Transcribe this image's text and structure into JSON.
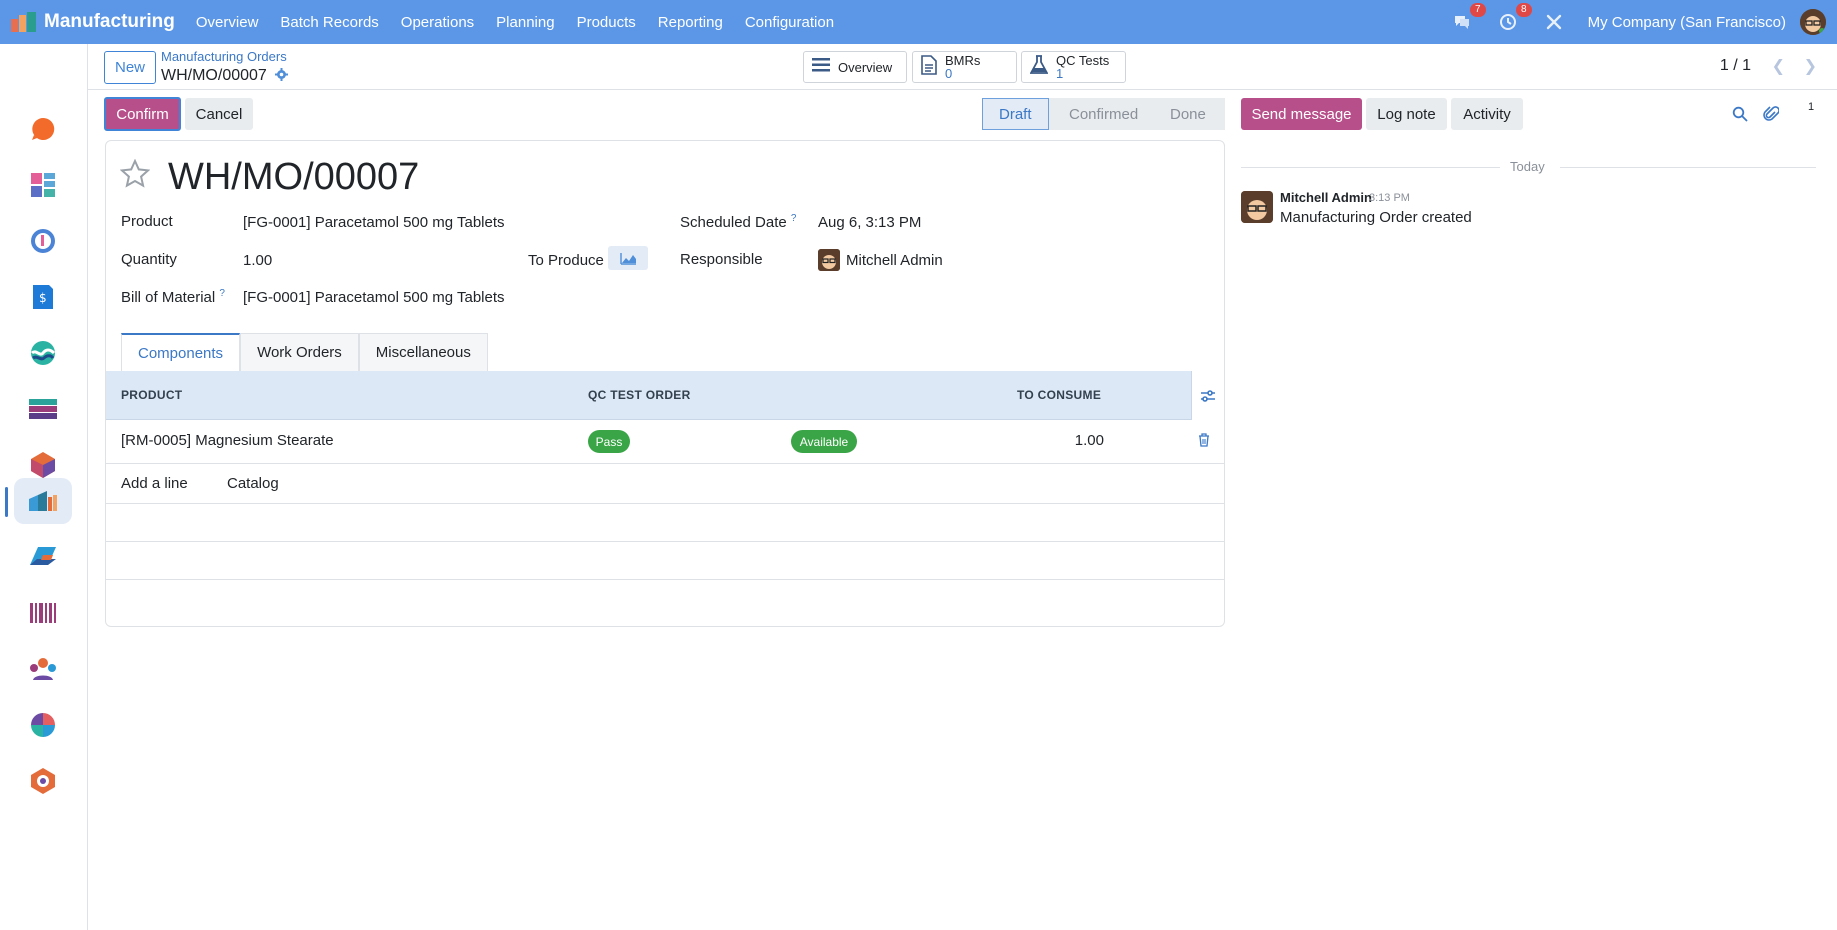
{
  "navbar": {
    "app_name": "Manufacturing",
    "menu": [
      "Overview",
      "Batch Records",
      "Operations",
      "Planning",
      "Products",
      "Reporting",
      "Configuration"
    ],
    "messages_badge": "7",
    "activities_badge": "8",
    "company": "My Company (San Francisco)"
  },
  "sidebar": {
    "apps": [
      "discuss",
      "dashboards",
      "calendar",
      "sales",
      "crm",
      "accounting",
      "inventory",
      "manufacturing",
      "documents",
      "barcode",
      "employees",
      "surveys",
      "quality"
    ],
    "active_app": "manufacturing"
  },
  "control": {
    "new_label": "New",
    "breadcrumb": "Manufacturing Orders",
    "record_name": "WH/MO/00007",
    "smart_buttons": {
      "overview": "Overview",
      "bmrs_label": "BMRs",
      "bmrs_value": "0",
      "qc_label": "QC Tests",
      "qc_value": "1"
    },
    "pager": "1 / 1"
  },
  "actions": {
    "confirm": "Confirm",
    "cancel": "Cancel"
  },
  "status": {
    "stages": [
      "Draft",
      "Confirmed",
      "Done"
    ],
    "current": "Draft"
  },
  "form": {
    "title": "WH/MO/00007",
    "product_label": "Product",
    "product": "[FG-0001] Paracetamol 500 mg Tablets",
    "quantity_label": "Quantity",
    "quantity": "1.00",
    "to_produce_label": "To Produce",
    "bom_label": "Bill of Material",
    "bom": "[FG-0001] Paracetamol 500 mg Tablets",
    "scheduled_label": "Scheduled Date",
    "scheduled": "Aug 6, 3:13 PM",
    "responsible_label": "Responsible",
    "responsible": "Mitchell Admin",
    "help_mark": "?"
  },
  "tabs": [
    "Components",
    "Work Orders",
    "Miscellaneous"
  ],
  "components": {
    "headers": [
      "PRODUCT",
      "QC TEST ORDER",
      "TO CONSUME"
    ],
    "rows": [
      {
        "product": "[RM-0005] Magnesium Stearate",
        "qc": "Pass",
        "availability": "Available",
        "to_consume": "1.00"
      }
    ],
    "add_line": "Add a line",
    "catalog": "Catalog"
  },
  "chatter": {
    "send_message": "Send message",
    "log_note": "Log note",
    "activity": "Activity",
    "followers_count": "1",
    "separator": "Today",
    "messages": [
      {
        "author": "Mitchell Admin",
        "time": "3:13 PM",
        "body": "Manufacturing Order created"
      }
    ]
  },
  "colors": {
    "navbar": "#5b97e6",
    "primary": "#b74f8a",
    "link": "#3b78c6",
    "success": "#3aa547"
  }
}
